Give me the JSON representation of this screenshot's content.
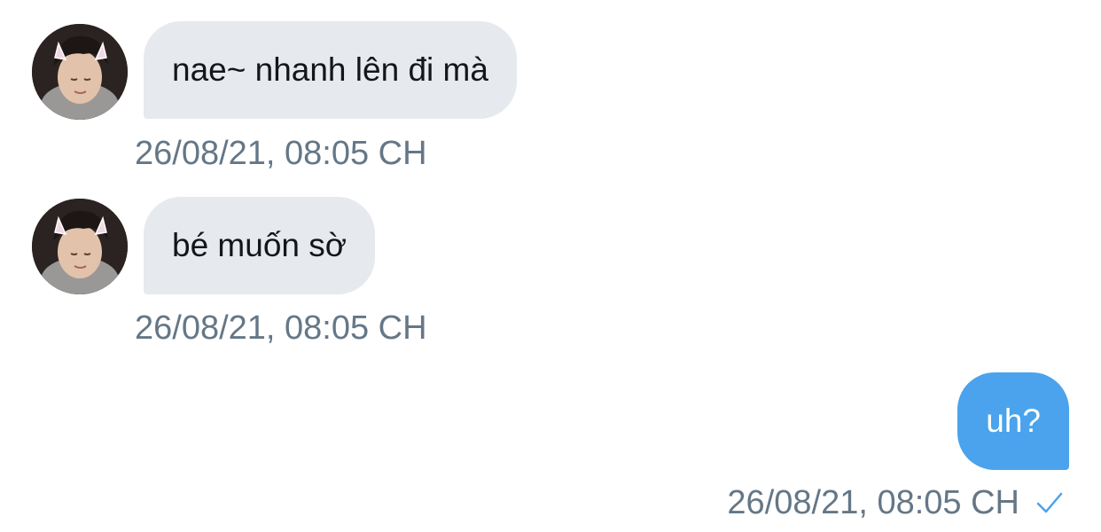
{
  "conversation": {
    "messages": [
      {
        "direction": "received",
        "text": "nae~ nhanh lên đi mà",
        "timestamp": "26/08/21, 08:05 CH",
        "avatar": "user-avatar"
      },
      {
        "direction": "received",
        "text": "bé muốn sờ",
        "timestamp": "26/08/21, 08:05 CH",
        "avatar": "user-avatar"
      },
      {
        "direction": "sent",
        "text": "uh?",
        "timestamp": "26/08/21, 08:05 CH",
        "status_icon": "checkmark-icon"
      }
    ]
  },
  "colors": {
    "received_bubble": "#e6e9ee",
    "received_text": "#14171a",
    "sent_bubble": "#4aa3ec",
    "sent_text": "#ffffff",
    "timestamp": "#657786",
    "checkmark": "#4aa3ec"
  }
}
